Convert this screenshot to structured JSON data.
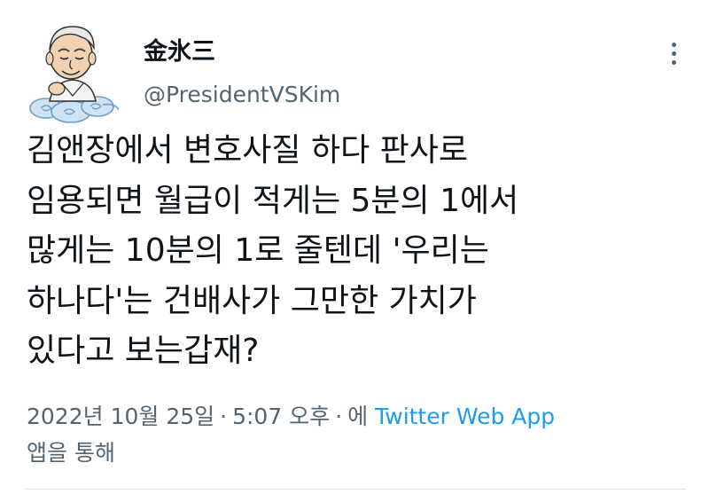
{
  "author": {
    "display_name": "金氷三",
    "handle": "@PresidentVSKim"
  },
  "menu": {
    "icon": "more-vertical-icon"
  },
  "tweet": {
    "lines": [
      "김앤장에서 변호사질 하다 판사로",
      "임용되면 월급이 적게는 5분의 1에서",
      "많게는 10분의 1로 줄텐데 '우리는",
      "하나다'는 건배사가 그만한 가치가",
      "있다고 보는갑재?"
    ]
  },
  "meta": {
    "date": "2022년 10월 25일",
    "separator": "·",
    "time": "5:07 오후",
    "via_prefix": "에",
    "app": "Twitter Web App",
    "via_suffix": "앱을 통해"
  },
  "colors": {
    "text": "#0f1419",
    "secondary": "#536471",
    "link": "#1d9bf0"
  }
}
